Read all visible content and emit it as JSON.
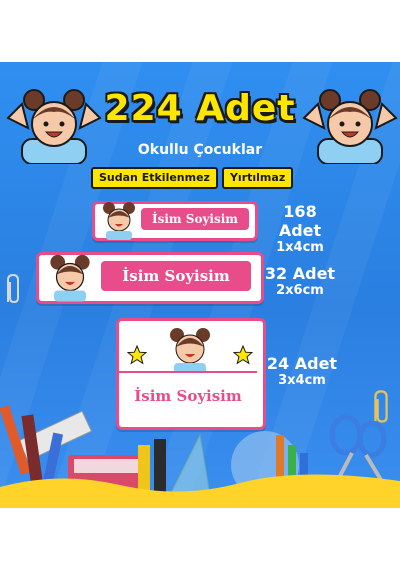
{
  "title": "224 Adet",
  "subtitle": "Okullu Çocuklar",
  "badges": [
    "Sudan Etkilenmez",
    "Yırtılmaz"
  ],
  "labels": [
    {
      "name": "İsim Soyisim",
      "count": "168 Adet",
      "size": "1x4cm"
    },
    {
      "name": "İsim Soyisim",
      "count": "32 Adet",
      "size": "2x6cm"
    },
    {
      "name": "İsim Soyisim",
      "count": "24 Adet",
      "size": "3x4cm"
    }
  ],
  "colors": {
    "background": "#2f8ff0",
    "title": "#ffe600",
    "label_accent": "#e84c8a",
    "badge": "#ffe600"
  },
  "icons": [
    "girl-mascot-icon",
    "star-icon",
    "pencil-icon",
    "scissors-icon",
    "ruler-icon",
    "book-icon",
    "paperclip-icon"
  ]
}
